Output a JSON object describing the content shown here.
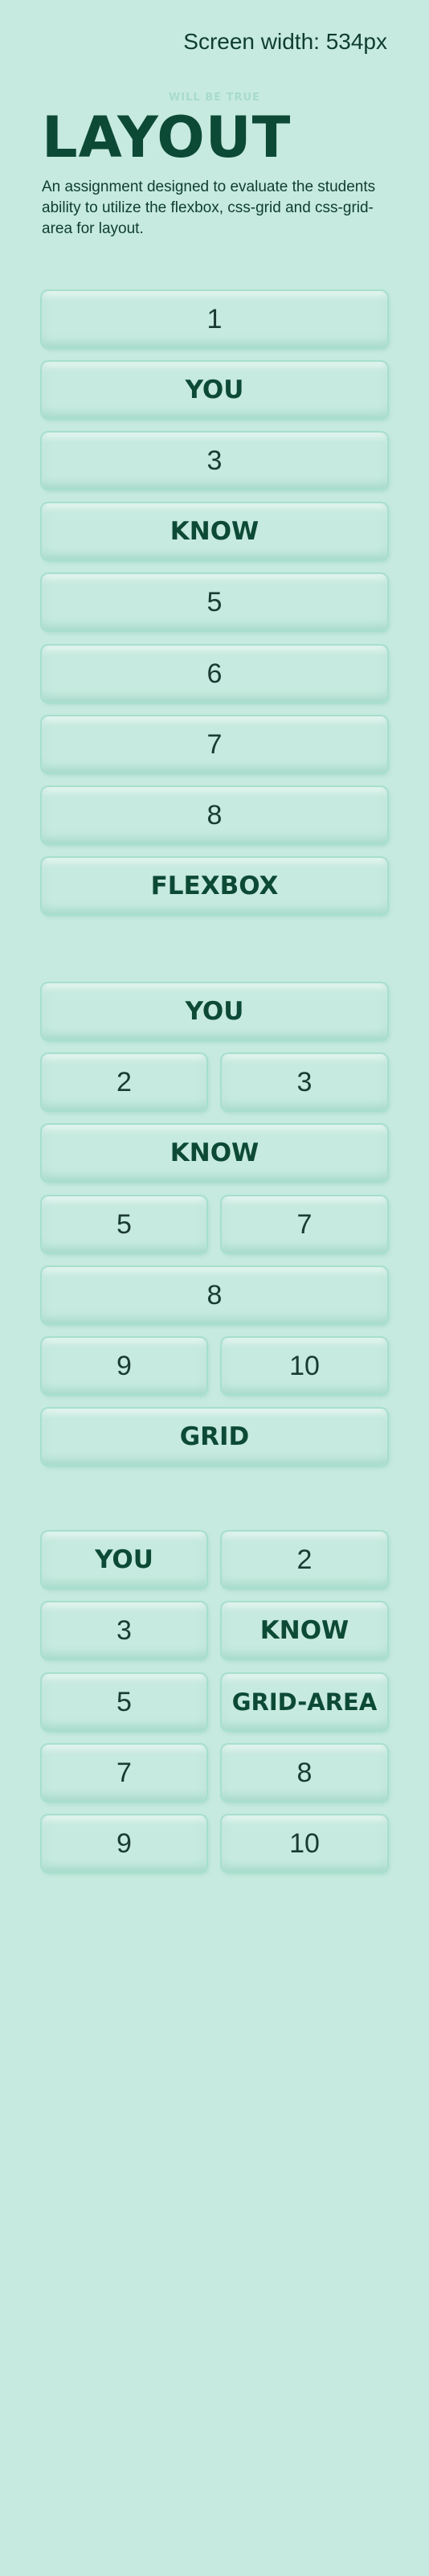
{
  "header": {
    "screen_width": "Screen width: 534px",
    "kicker": "WILL BE TRUE",
    "title": "LAYOUT",
    "description": "An assignment designed to evaluate the students ability to utilize the flexbox, css-grid and css-grid-area for layout."
  },
  "flexbox": [
    "1",
    "YOU",
    "3",
    "KNOW",
    "5",
    "6",
    "7",
    "8",
    "FLEXBOX"
  ],
  "grid": [
    "YOU",
    "2",
    "3",
    "KNOW",
    "5",
    "7",
    "8",
    "9",
    "10",
    "GRID"
  ],
  "grid_area": [
    "YOU",
    "2",
    "3",
    "KNOW",
    "5",
    "GRID-AREA",
    "7",
    "8",
    "9",
    "10"
  ]
}
